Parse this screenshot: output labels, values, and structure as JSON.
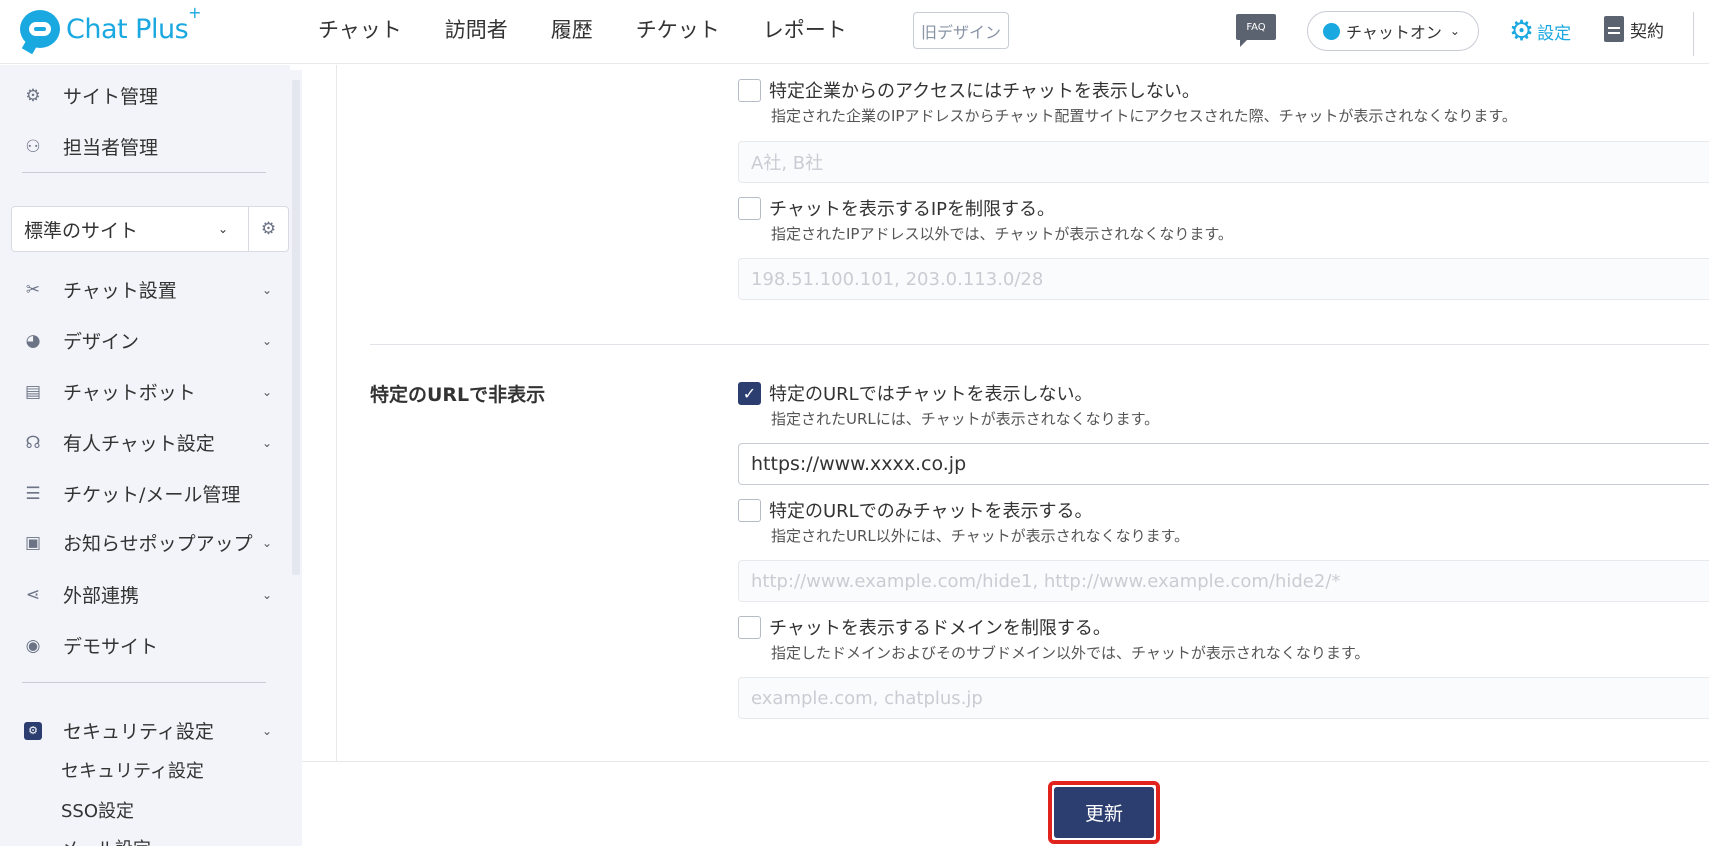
{
  "header": {
    "logo_text": "Chat Plus",
    "logo_sup": "+",
    "nav": [
      "チャット",
      "訪問者",
      "履歴",
      "チケット",
      "レポート"
    ],
    "old_design": "旧デザイン",
    "faq": "FAQ",
    "chat_status": "チャットオン",
    "settings": "設定",
    "contract": "契約"
  },
  "sidebar": {
    "site_admin": "サイト管理",
    "staff_admin": "担当者管理",
    "site_select": "標準のサイト",
    "items": [
      "チャット設置",
      "デザイン",
      "チャットボット",
      "有人チャット設定",
      "チケット/メール管理",
      "お知らせポップアップ",
      "外部連携",
      "デモサイト"
    ],
    "security": "セキュリティ設定",
    "sub": [
      "セキュリティ設定",
      "SSO設定",
      "メール設定"
    ]
  },
  "main": {
    "company_cb": "特定企業からのアクセスにはチャットを表示しない。",
    "company_desc": "指定された企業のIPアドレスからチャット配置サイトにアクセスされた際、チャットが表示されなくなります。",
    "company_placeholder": "A社, B社",
    "ip_cb": "チャットを表示するIPを制限する。",
    "ip_desc": "指定されたIPアドレス以外では、チャットが表示されなくなります。",
    "ip_placeholder": "198.51.100.101, 203.0.113.0/28",
    "url_section_title": "特定のURLで非表示",
    "url_hide_cb": "特定のURLではチャットを表示しない。",
    "url_hide_desc": "指定されたURLには、チャットが表示されなくなります。",
    "url_hide_value": "https://www.xxxx.co.jp",
    "url_only_cb": "特定のURLでのみチャットを表示する。",
    "url_only_desc": "指定されたURL以外には、チャットが表示されなくなります。",
    "url_only_placeholder": "http://www.example.com/hide1, http://www.example.com/hide2/*",
    "domain_cb": "チャットを表示するドメインを制限する。",
    "domain_desc": "指定したドメインおよびそのサブドメイン以外では、チャットが表示されなくなります。",
    "domain_placeholder": "example.com, chatplus.jp",
    "update_button": "更新"
  }
}
